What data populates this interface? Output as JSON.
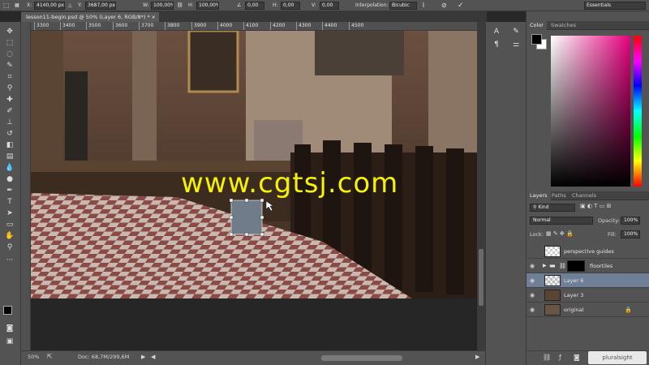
{
  "options_bar": {
    "x_label": "X:",
    "x_value": "4140,00 px",
    "y_label": "Y:",
    "y_value": "3687,00 px",
    "w_label": "W:",
    "w_value": "100,00%",
    "h_label": "H:",
    "h_value": "100,00%",
    "angle_value": "0,00",
    "hskew_label": "H:",
    "hskew_value": "0,00",
    "vskew_label": "V:",
    "vskew_value": "0,00",
    "interp_label": "Interpolation:",
    "interp_value": "Bicubic",
    "workspace": "Essentials"
  },
  "document_tab": {
    "title": "lesson11-begin.psd @ 50% (Layer 6, RGB/8*) *",
    "close": "×"
  },
  "ruler_ticks": [
    "3300",
    "3400",
    "3500",
    "3600",
    "3700",
    "3800",
    "3900",
    "4000",
    "4100",
    "4200",
    "4300",
    "4400",
    "4500"
  ],
  "watermark": "www.cgtsj.com",
  "status_bar": {
    "zoom": "50%",
    "doc": "Doc: 68,7M/299,6M"
  },
  "color_panel": {
    "tab_color": "Color",
    "tab_swatches": "Swatches",
    "foreground": "#000000",
    "background": "#ffffff"
  },
  "layers_panel": {
    "tab_layers": "Layers",
    "tab_paths": "Paths",
    "tab_channels": "Channels",
    "kind": "Kind",
    "blend_mode": "Normal",
    "opacity_label": "Opacity:",
    "opacity_value": "100%",
    "lock_label": "Lock:",
    "fill_label": "Fill:",
    "fill_value": "100%",
    "layers": [
      {
        "name": "perspective guides"
      },
      {
        "name": "floortiles"
      },
      {
        "name": "Layer 6"
      },
      {
        "name": "Layer 3"
      },
      {
        "name": "original"
      }
    ]
  },
  "pluralsight": "pluralsight"
}
